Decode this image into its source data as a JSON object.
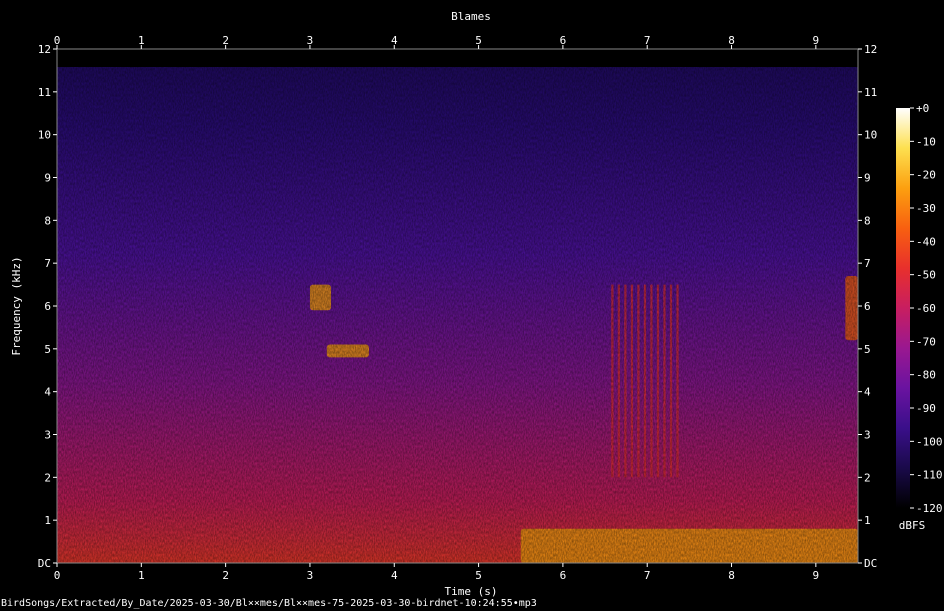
{
  "chart_data": {
    "type": "heatmap",
    "title": "Blames",
    "xlabel": "Time (s)",
    "ylabel": "Frequency (kHz)",
    "xlim": [
      0,
      9.5
    ],
    "ylim": [
      0,
      12
    ],
    "x_ticks": [
      "0",
      "1",
      "2",
      "3",
      "4",
      "5",
      "6",
      "7",
      "8",
      "9"
    ],
    "y_ticks": [
      "DC",
      "1",
      "2",
      "3",
      "4",
      "5",
      "6",
      "7",
      "8",
      "9",
      "10",
      "11",
      "12"
    ],
    "colorbar": {
      "label": "dBFS",
      "range": [
        -120,
        0
      ],
      "ticks": [
        "+0",
        "-10",
        "-20",
        "-30",
        "-40",
        "-50",
        "-60",
        "-70",
        "-80",
        "-90",
        "-100",
        "-110",
        "-120"
      ],
      "colors": [
        "#000000",
        "#1a0a4a",
        "#3a0f8a",
        "#6a13a0",
        "#9a1890",
        "#c81e60",
        "#e8302c",
        "#f86010",
        "#fca010",
        "#fde050",
        "#ffffff"
      ]
    },
    "events": [
      {
        "label": "call",
        "t_start": 3.0,
        "t_end": 3.25,
        "f_low_khz": 5.9,
        "f_high_khz": 6.5,
        "level_dbfs": -30
      },
      {
        "label": "call",
        "t_start": 3.2,
        "t_end": 3.7,
        "f_low_khz": 4.8,
        "f_high_khz": 5.1,
        "level_dbfs": -20
      },
      {
        "label": "pulse train",
        "t_start": 6.55,
        "t_end": 7.4,
        "f_low_khz": 2.0,
        "f_high_khz": 6.5,
        "level_dbfs": -45
      },
      {
        "label": "low-frequency noise",
        "t_start": 5.5,
        "t_end": 9.5,
        "f_low_khz": 0.0,
        "f_high_khz": 0.8,
        "level_dbfs": -20
      },
      {
        "label": "call",
        "t_start": 9.35,
        "t_end": 9.5,
        "f_low_khz": 5.2,
        "f_high_khz": 6.7,
        "level_dbfs": -40
      }
    ]
  },
  "footer": "BirdSongs/Extracted/By_Date/2025-03-30/Bl××mes/Bl××mes-75-2025-03-30-birdnet-10:24:55∙mp3"
}
